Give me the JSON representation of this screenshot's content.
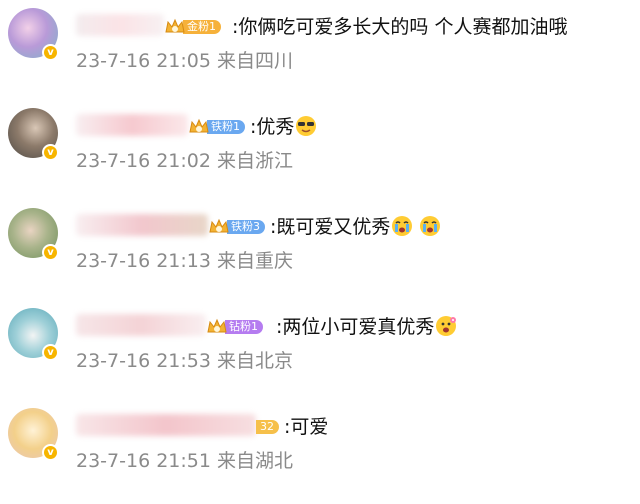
{
  "comments": [
    {
      "fan_level": "金粉1",
      "text": ":你俩吃可爱多长大的吗 个人赛都加油哦",
      "date": "23-7-16",
      "time": "21:05",
      "location": "来自四川",
      "badge_color": "#f6b13a"
    },
    {
      "fan_level": "铁粉1",
      "text": ":优秀",
      "date": "23-7-16",
      "time": "21:02",
      "location": "来自浙江",
      "badge_color": "#6aa8f0"
    },
    {
      "fan_level": "铁粉3",
      "text": ":既可爱又优秀",
      "date": "23-7-16",
      "time": "21:13",
      "location": "来自重庆",
      "badge_color": "#6aa8f0"
    },
    {
      "fan_level": "钻粉1",
      "text": ":两位小可爱真优秀",
      "date": "23-7-16",
      "time": "21:53",
      "location": "来自北京",
      "badge_color": "#b57cf0"
    },
    {
      "fan_level": "32",
      "text": ":可爱",
      "date": "23-7-16",
      "time": "21:51",
      "location": "来自湖北",
      "badge_color": "#f6c04a"
    }
  ],
  "icons": {
    "verified": "verified-v-icon",
    "fan_crown": "crown-icon",
    "emoji_cool": "sunglasses-emoji-icon",
    "emoji_cry": "crying-emoji-icon",
    "emoji_flower": "flower-emoji-icon"
  },
  "verified_glyph": "v"
}
